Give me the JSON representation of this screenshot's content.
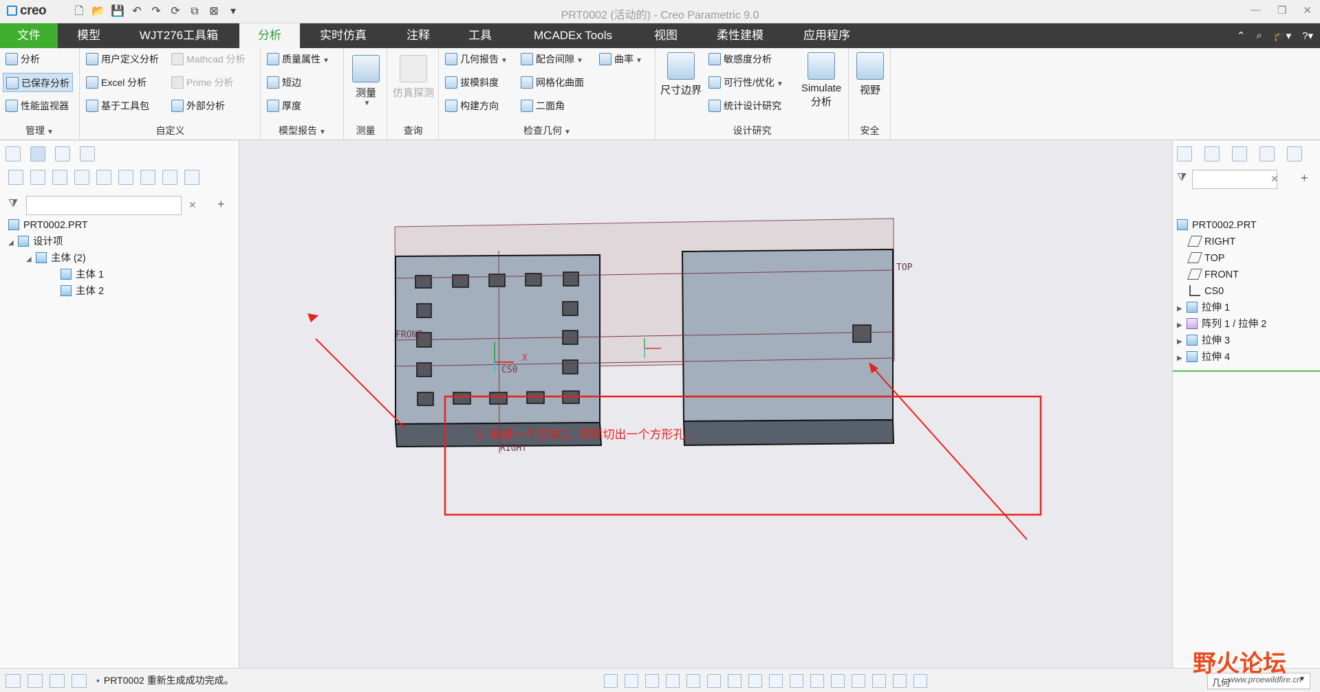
{
  "app": {
    "logo": "creo",
    "window_title": "PRT0002 (活动的) - Creo Parametric 9.0"
  },
  "menu": {
    "tabs": [
      {
        "label": "文件"
      },
      {
        "label": "模型"
      },
      {
        "label": "WJT276工具箱"
      },
      {
        "label": "分析"
      },
      {
        "label": "实时仿真"
      },
      {
        "label": "注释"
      },
      {
        "label": "工具"
      },
      {
        "label": "MCADEx Tools"
      },
      {
        "label": "视图"
      },
      {
        "label": "柔性建模"
      },
      {
        "label": "应用程序"
      }
    ],
    "active_tab": "分析"
  },
  "ribbon": {
    "manage": {
      "title": "管理",
      "analysis": "分析",
      "saved_analysis": "已保存分析",
      "perf_monitor": "性能监视器"
    },
    "custom": {
      "title": "自定义",
      "user_defined": "用户定义分析",
      "excel": "Excel 分析",
      "toolkit": "基于工具包",
      "mathcad": "Mathcad 分析",
      "prime": "Prime 分析",
      "external": "外部分析"
    },
    "model_report": {
      "title": "模型报告",
      "mass_props": "质量属性",
      "short_edge": "短边",
      "thickness": "厚度"
    },
    "measure": {
      "title": "测量",
      "label": "测量"
    },
    "query": {
      "title": "查询",
      "label": "仿真探测"
    },
    "inspect_geom": {
      "title": "检查几何",
      "geom_report": "几何报告",
      "clearance": "配合间隙",
      "curvature": "曲率",
      "draft": "拔模斜度",
      "meshed_surface": "网格化曲面",
      "build_direction": "构建方向",
      "dihedral": "二面角"
    },
    "design_study": {
      "title": "设计研究",
      "dim_boundary": "尺寸边界",
      "sensitivity": "敏感度分析",
      "feasibility": "可行性/优化",
      "statistical": "统计设计研究",
      "simulate_1": "Simulate",
      "simulate_2": "分析"
    },
    "safety": {
      "title": "安全",
      "view": "视野"
    }
  },
  "left_tree": {
    "items": [
      {
        "label": "PRT0002.PRT"
      },
      {
        "label": "设计项"
      },
      {
        "label": "主体 (2)"
      },
      {
        "label": "主体 1"
      },
      {
        "label": "主体 2"
      }
    ]
  },
  "right_tree": {
    "items": [
      {
        "label": "PRT0002.PRT"
      },
      {
        "label": "RIGHT"
      },
      {
        "label": "TOP"
      },
      {
        "label": "FRONT"
      },
      {
        "label": "CS0"
      },
      {
        "label": "拉伸 1"
      },
      {
        "label": "阵列 1 / 拉伸 2"
      },
      {
        "label": "拉伸 3"
      },
      {
        "label": "拉伸 4"
      }
    ]
  },
  "viewport": {
    "datum_labels": {
      "top": "TOP",
      "front": "FRONT",
      "right": "RIGHT",
      "csys": "CS0",
      "x_axis": "X"
    },
    "annotation_note": "5. 新建一个文体2，同样切出一个方形孔，"
  },
  "status": {
    "message": "PRT0002 重新生成成功完成。",
    "filter_value": "几何"
  },
  "watermark": {
    "main": "野火论坛",
    "sub": "www.proewildfire.cn"
  },
  "colors": {
    "file_tab": "#3fae2e",
    "active_tab_text": "#2e9d30",
    "menu_bg": "#3c3c3c",
    "body_fill": "#a3afbd",
    "annotation_red": "#e8211c"
  }
}
